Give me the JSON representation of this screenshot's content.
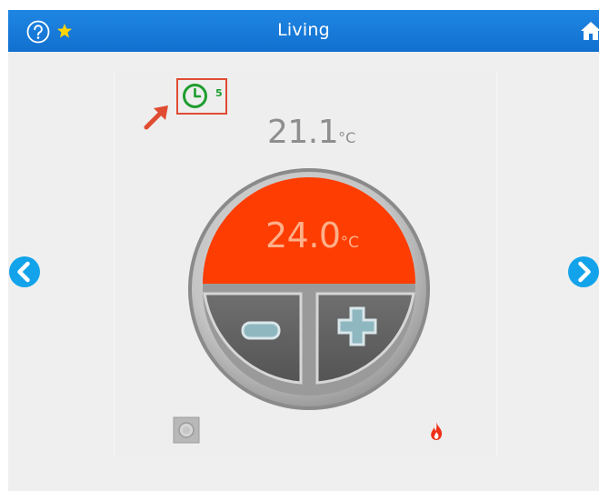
{
  "header": {
    "title": "Living",
    "help_icon": "question-circle-icon",
    "favorite_icon": "star-icon",
    "home_icon": "home-icon"
  },
  "thermostat": {
    "schedule_count": "5",
    "current_temp": {
      "value": "21.1",
      "unit": "°C"
    },
    "setpoint": {
      "value": "24.0",
      "unit": "°C"
    },
    "minus_icon": "minus-icon",
    "plus_icon": "plus-icon",
    "mode_icon": "mode-square-icon",
    "heating_icon": "flame-icon"
  },
  "navigation": {
    "prev_icon": "chevron-left-icon",
    "next_icon": "chevron-right-icon"
  },
  "colors": {
    "header": "#1270cf",
    "setpoint_fill": "#fe3d02",
    "setpoint_text": "#ffb08a",
    "schedule_green": "#1e9d2e",
    "highlight_red": "#e04c32",
    "nav_blue": "#12a3ea"
  }
}
